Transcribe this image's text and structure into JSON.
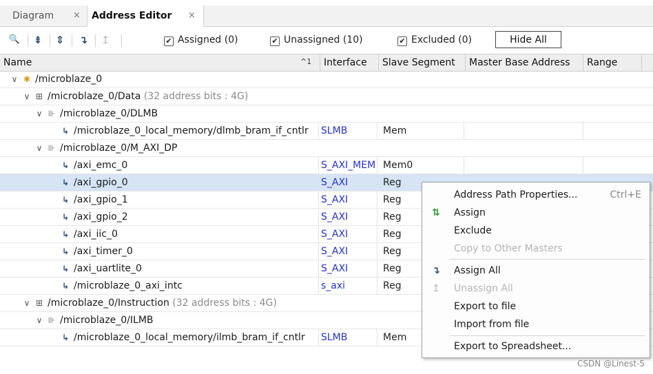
{
  "tabs": [
    {
      "label": "Diagram",
      "close": "×"
    },
    {
      "label": "Address Editor",
      "close": "×"
    }
  ],
  "toolbar": {
    "icons": [
      "search-icon",
      "collapse-all-icon",
      "expand-all-icon",
      "assign-all-icon",
      "unassign-all-icon"
    ],
    "glyphs": {
      "search": "🔍",
      "collapse": "⇟",
      "expand": "⇕",
      "assign": "↴",
      "unassign": "↥"
    },
    "checkbox_mark": "✔",
    "assigned": "Assigned (0)",
    "unassigned": "Unassigned (10)",
    "excluded": "Excluded (0)",
    "hide_all": "Hide All"
  },
  "columns": {
    "name": "Name",
    "sort": "^1",
    "interface": "Interface",
    "slave_segment": "Slave Segment",
    "master_base_address": "Master Base Address",
    "range": "Range"
  },
  "glyphs": {
    "expanded": "∨",
    "segment": "↳",
    "microblaze": "✱",
    "space": "⊞",
    "map": "⊪"
  },
  "rows": [
    {
      "name": "/microblaze_0",
      "extra": "",
      "interface": "",
      "slave": ""
    },
    {
      "name": "/microblaze_0/Data",
      "extra": "(32 address bits : 4G)",
      "interface": "",
      "slave": ""
    },
    {
      "name": "/microblaze_0/DLMB",
      "extra": "",
      "interface": "",
      "slave": ""
    },
    {
      "name": "/microblaze_0_local_memory/dlmb_bram_if_cntlr",
      "extra": "",
      "interface": "SLMB",
      "slave": "Mem"
    },
    {
      "name": "/microblaze_0/M_AXI_DP",
      "extra": "",
      "interface": "",
      "slave": ""
    },
    {
      "name": "/axi_emc_0",
      "extra": "",
      "interface": "S_AXI_MEM",
      "slave": "Mem0"
    },
    {
      "name": "/axi_gpio_0",
      "extra": "",
      "interface": "S_AXI",
      "slave": "Reg"
    },
    {
      "name": "/axi_gpio_1",
      "extra": "",
      "interface": "S_AXI",
      "slave": "Reg"
    },
    {
      "name": "/axi_gpio_2",
      "extra": "",
      "interface": "S_AXI",
      "slave": "Reg"
    },
    {
      "name": "/axi_iic_0",
      "extra": "",
      "interface": "S_AXI",
      "slave": "Reg"
    },
    {
      "name": "/axi_timer_0",
      "extra": "",
      "interface": "S_AXI",
      "slave": "Reg"
    },
    {
      "name": "/axi_uartlite_0",
      "extra": "",
      "interface": "S_AXI",
      "slave": "Reg"
    },
    {
      "name": "/microblaze_0_axi_intc",
      "extra": "",
      "interface": "s_axi",
      "slave": "Reg"
    },
    {
      "name": "/microblaze_0/Instruction",
      "extra": "(32 address bits : 4G)",
      "interface": "",
      "slave": ""
    },
    {
      "name": "/microblaze_0/ILMB",
      "extra": "",
      "interface": "",
      "slave": ""
    },
    {
      "name": "/microblaze_0_local_memory/ilmb_bram_if_cntlr",
      "extra": "",
      "interface": "SLMB",
      "slave": "Mem"
    }
  ],
  "menu": {
    "address_path_properties": "Address Path Properties...",
    "shortcut": "Ctrl+E",
    "assign": "Assign",
    "exclude": "Exclude",
    "copy_to_other_masters": "Copy to Other Masters",
    "assign_all": "Assign All",
    "unassign_all": "Unassign All",
    "export_to_file": "Export to file",
    "import_from_file": "Import from file",
    "export_to_spreadsheet": "Export to Spreadsheet...",
    "glyphs": {
      "assign": "⇅",
      "assign_all": "↴",
      "unassign_all": "↥"
    }
  },
  "watermark": "CSDN @Linest-5"
}
